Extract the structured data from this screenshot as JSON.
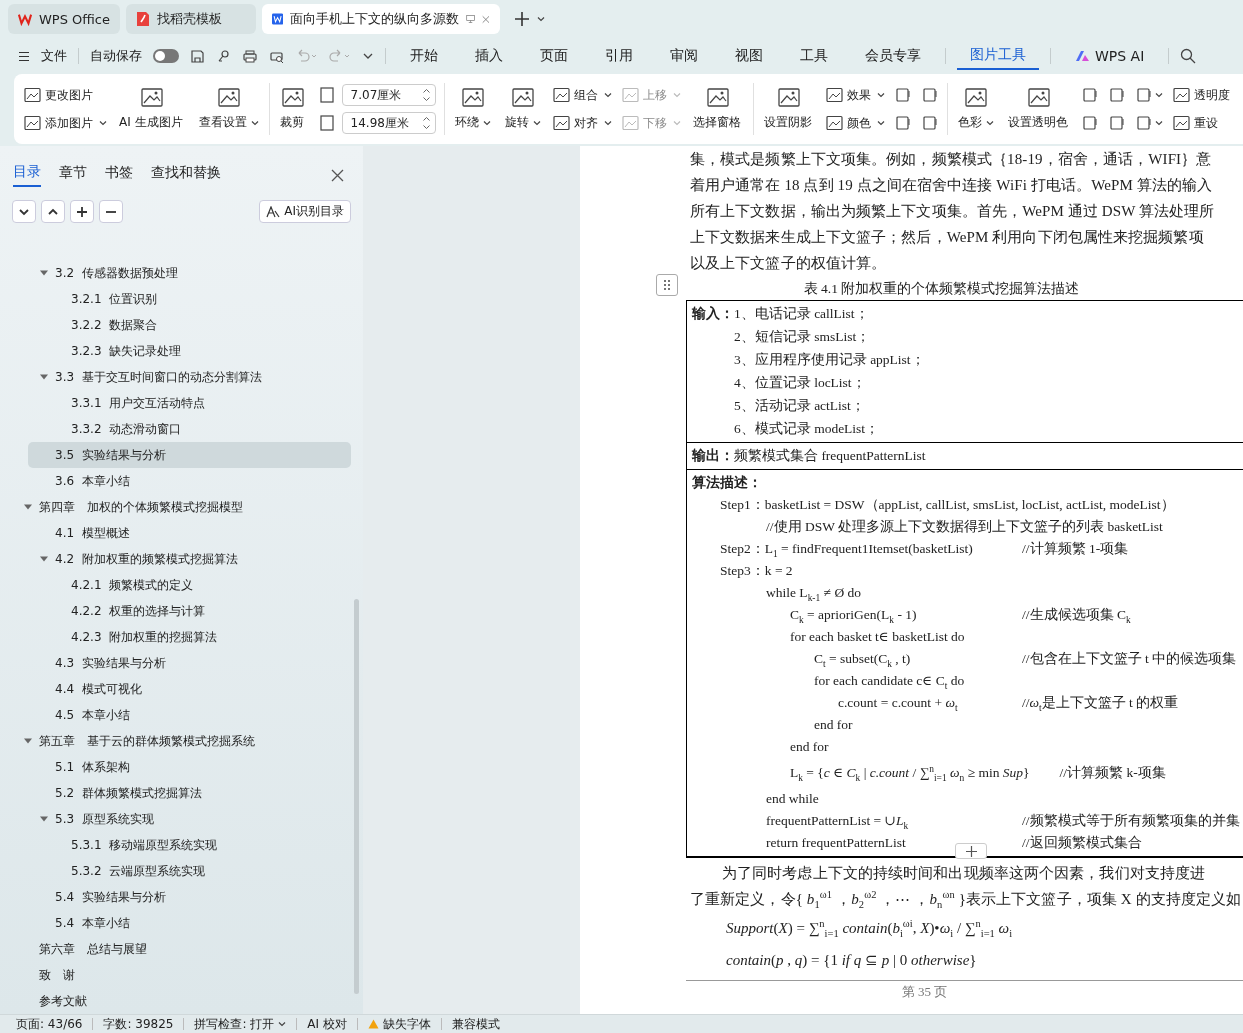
{
  "window_tabs": [
    {
      "kind": "home",
      "label": "WPS Office",
      "selected": false
    },
    {
      "kind": "template",
      "label": "找稻壳模板",
      "selected": false
    },
    {
      "kind": "document",
      "label": "面向手机上下文的纵向多源数",
      "selected": true
    }
  ],
  "menu_bar": {
    "file": "文件",
    "autosave": {
      "label": "自动保存",
      "on": false
    },
    "tabs": [
      {
        "label": "开始",
        "selected": false
      },
      {
        "label": "插入",
        "selected": false
      },
      {
        "label": "页面",
        "selected": false
      },
      {
        "label": "引用",
        "selected": false
      },
      {
        "label": "审阅",
        "selected": false
      },
      {
        "label": "视图",
        "selected": false
      },
      {
        "label": "工具",
        "selected": false
      },
      {
        "label": "会员专享",
        "selected": false
      },
      {
        "label": "图片工具",
        "selected": true
      },
      {
        "label": "WPS AI",
        "selected": false
      }
    ]
  },
  "ribbon": {
    "groups": [
      {
        "columns": [
          [
            {
              "kind": "small",
              "label": "更改图片",
              "menu": false,
              "disabled": false
            },
            {
              "kind": "small",
              "label": "添加图片",
              "menu": true,
              "disabled": false
            }
          ],
          [
            {
              "kind": "large",
              "label": "AI 生成图片",
              "menu": false,
              "disabled": false
            }
          ],
          [
            {
              "kind": "large",
              "label": "查看设置",
              "menu": true,
              "disabled": false
            }
          ]
        ]
      },
      {
        "columns": [
          [
            {
              "kind": "large",
              "label": "裁剪",
              "menu": false,
              "disabled": false
            }
          ],
          [
            {
              "kind": "field",
              "value": "7.07厘米"
            },
            {
              "kind": "field",
              "value": "14.98厘米"
            }
          ]
        ]
      },
      {
        "columns": [
          [
            {
              "kind": "large",
              "label": "环绕",
              "menu": true,
              "disabled": false
            }
          ],
          [
            {
              "kind": "large",
              "label": "旋转",
              "menu": true,
              "disabled": false
            }
          ],
          [
            {
              "kind": "small",
              "label": "组合",
              "menu": true,
              "disabled": false
            },
            {
              "kind": "small",
              "label": "对齐",
              "menu": true,
              "disabled": false
            }
          ],
          [
            {
              "kind": "small",
              "label": "上移",
              "menu": true,
              "disabled": true
            },
            {
              "kind": "small",
              "label": "下移",
              "menu": true,
              "disabled": true
            }
          ],
          [
            {
              "kind": "large",
              "label": "选择窗格",
              "menu": false,
              "disabled": false
            }
          ]
        ]
      },
      {
        "columns": [
          [
            {
              "kind": "large",
              "label": "设置阴影",
              "menu": false,
              "disabled": false
            }
          ],
          [
            {
              "kind": "small",
              "label": "效果",
              "menu": true,
              "disabled": false
            },
            {
              "kind": "small",
              "label": "颜色",
              "menu": true,
              "disabled": false
            }
          ],
          [
            {
              "kind": "icon",
              "menu": false,
              "disabled": false
            },
            {
              "kind": "icon",
              "menu": false,
              "disabled": false
            }
          ],
          [
            {
              "kind": "icon",
              "menu": false,
              "disabled": false
            },
            {
              "kind": "icon",
              "menu": false,
              "disabled": false
            }
          ]
        ]
      },
      {
        "columns": [
          [
            {
              "kind": "large",
              "label": "色彩",
              "menu": true,
              "disabled": false
            }
          ],
          [
            {
              "kind": "large",
              "label": "设置透明色",
              "menu": false,
              "disabled": false
            }
          ],
          [
            {
              "kind": "icon",
              "menu": false,
              "disabled": false
            },
            {
              "kind": "icon",
              "menu": false,
              "disabled": false
            }
          ],
          [
            {
              "kind": "icon",
              "menu": false,
              "disabled": false
            },
            {
              "kind": "icon",
              "menu": false,
              "disabled": false
            }
          ],
          [
            {
              "kind": "icon",
              "menu": true,
              "disabled": false
            },
            {
              "kind": "icon",
              "menu": true,
              "disabled": false
            }
          ],
          [
            {
              "kind": "small",
              "label": "透明度",
              "menu": false,
              "disabled": false
            },
            {
              "kind": "small",
              "label": "重设",
              "menu": false,
              "disabled": false
            }
          ]
        ]
      }
    ]
  },
  "sidebar": {
    "tabs": [
      {
        "label": "目录",
        "selected": true
      },
      {
        "label": "章节",
        "selected": false
      },
      {
        "label": "书签",
        "selected": false
      },
      {
        "label": "查找和替换",
        "selected": false
      }
    ],
    "ai_button": "AI识别目录",
    "continued_sections": [
      {
        "label": "3.2  传感器数据预处理",
        "selected": false,
        "expanded": true,
        "children": [
          {
            "label": "3.2.1  位置识别",
            "selected": false
          },
          {
            "label": "3.2.2  数据聚合",
            "selected": false
          },
          {
            "label": "3.2.3  缺失记录处理",
            "selected": false
          }
        ]
      },
      {
        "label": "3.3  基于交互时间窗口的动态分割算法",
        "selected": false,
        "expanded": true,
        "children": [
          {
            "label": "3.3.1  用户交互活动特点",
            "selected": false
          },
          {
            "label": "3.3.2  动态滑动窗口",
            "selected": false
          }
        ]
      },
      {
        "label": "3.5  实验结果与分析",
        "selected": true
      },
      {
        "label": "3.6  本章小结",
        "selected": false
      }
    ],
    "chapters": [
      {
        "label": "第四章　加权的个体频繁模式挖掘模型",
        "selected": false,
        "expanded": true,
        "children": [
          {
            "label": "4.1  模型概述",
            "selected": false
          },
          {
            "label": "4.2  附加权重的频繁模式挖掘算法",
            "selected": false,
            "expanded": true,
            "children": [
              {
                "label": "4.2.1  频繁模式的定义",
                "selected": false
              },
              {
                "label": "4.2.2  权重的选择与计算",
                "selected": false
              },
              {
                "label": "4.2.3  附加权重的挖掘算法",
                "selected": false
              }
            ]
          },
          {
            "label": "4.3  实验结果与分析",
            "selected": false
          },
          {
            "label": "4.4  模式可视化",
            "selected": false
          },
          {
            "label": "4.5  本章小结",
            "selected": false
          }
        ]
      },
      {
        "label": "第五章　基于云的群体频繁模式挖掘系统",
        "selected": false,
        "expanded": true,
        "children": [
          {
            "label": "5.1  体系架构",
            "selected": false
          },
          {
            "label": "5.2  群体频繁模式挖掘算法",
            "selected": false
          },
          {
            "label": "5.3  原型系统实现",
            "selected": false,
            "expanded": true,
            "children": [
              {
                "label": "5.3.1  移动端原型系统实现",
                "selected": false
              },
              {
                "label": "5.3.2  云端原型系统实现",
                "selected": false
              }
            ]
          },
          {
            "label": "5.4  实验结果与分析",
            "selected": false
          },
          {
            "label": "5.4  本章小结",
            "selected": false
          }
        ]
      },
      {
        "label": "第六章　总结与展望",
        "selected": false
      },
      {
        "label": "致　谢",
        "selected": false
      },
      {
        "label": "参考文献",
        "selected": false
      }
    ]
  },
  "document": {
    "paragraph_lines": [
      "集，模式是频繁上下文项集。例如，频繁模式｛18-19，宿舍，通话，WIFI｝意",
      "着用户通常在 18 点到 19 点之间在宿舍中连接 WiFi 打电话。WePM 算法的输入",
      "所有上下文数据，输出为频繁上下文项集。首先，WePM 通过 DSW 算法处理所",
      "上下文数据来生成上下文篮子；然后，WePM 利用向下闭包属性来挖掘频繁项",
      "以及上下文篮子的权值计算。"
    ],
    "caption": "表 4.1  附加权重的个体频繁模式挖掘算法描述",
    "table": {
      "input_label": "输入：",
      "inputs": [
        "1、电话记录 callList；",
        "2、短信记录 smsList；",
        "3、应用程序使用记录 appList；",
        "4、位置记录 locList；",
        "5、活动记录 actList；",
        "6、模式记录 modeList；"
      ],
      "output_label": "输出：",
      "output": "频繁模式集合 frequentPatternList",
      "algorithm_label": "算法描述：",
      "algorithm": [
        {
          "code": "Step1：basketList = DSW（appList, callList, smsList, locList, actList, modeList）",
          "children": [
            {
              "code": "//使用 DSW 处理多源上下文数据得到上下文篮子的列表 basketList"
            }
          ]
        },
        {
          "code": "Step2：L$_{1}$ = findFrequent1Itemset(basketList)",
          "comment": "//计算频繁 1-项集"
        },
        {
          "code": "Step3：k = 2",
          "children": [
            {
              "code": "while L$_{k-1}$ ≠ Ø do",
              "children": [
                {
                  "code": "C$_{k}$ = aprioriGen(L$_{k}$ - 1)",
                  "comment": "//生成候选项集 C$_{k}$"
                },
                {
                  "code": "for each basket t∈ basketList do",
                  "children": [
                    {
                      "code": "C$_{t}$ = subset(C$_{k}$ , t)",
                      "comment": "//包含在上下文篮子 t 中的候选项集"
                    },
                    {
                      "code": "for each candidate c∈ C$_{t}$ do",
                      "children": [
                        {
                          "code": "c.count = c.count + *ω*$_{t}$",
                          "comment": "//*ω*$_{t}$是上下文篮子 t 的权重"
                        }
                      ]
                    },
                    {
                      "code": "end for"
                    }
                  ]
                },
                {
                  "code": "end for"
                },
                {
                  "code": "L$_{k}$ = {*c* ∈ *C*$_{k}$ | *c.count* / ∑$^{n}$$_{i=1}$ *ω*$_{n}$ ≥ min *Sup*}",
                  "comment": "//计算频繁 k-项集"
                }
              ]
            },
            {
              "code": "end while"
            },
            {
              "code": "frequentPatternList = ∪*L*$_{k}$",
              "comment": "//频繁模式等于所有频繁项集的并集"
            },
            {
              "code": "return frequentPatternList",
              "comment": "//返回频繁模式集合"
            }
          ]
        }
      ]
    },
    "paragraph2_lines": [
      "为了同时考虑上下文的持续时间和出现频率这两个因素，我们对支持度进",
      "了重新定义，令{ *b*$_{1}$$^{ω1}$ ，*b*$_{2}$$^{ω2}$ ，⋯ ，*b*$_{n}$$^{ωn}$ }表示上下文篮子，项集 X 的支持度定义如"
    ],
    "formulas": [
      "*Support*(*X*) = ∑$^{n}$$_{i=1}$ *contain*(*b*$_{i}$$^{ωi}$, *X*)•*ω*$_{i}$ / ∑$^{n}$$_{i=1}$ *ω*$_{i}$",
      "*contain*(*p* , *q*) = {1 *if q* ⊆ *p* | 0  *otherwise*}"
    ],
    "page_number": "第 35 页"
  },
  "status_bar": [
    {
      "kind": "text",
      "label": "页面: 43/66"
    },
    {
      "kind": "text",
      "label": "字数: 39825"
    },
    {
      "kind": "dropdown",
      "label": "拼写检查: 打开"
    },
    {
      "kind": "text",
      "label": "AI 校对"
    },
    {
      "kind": "warning",
      "label": "缺失字体"
    },
    {
      "kind": "text",
      "label": "兼容模式"
    }
  ]
}
